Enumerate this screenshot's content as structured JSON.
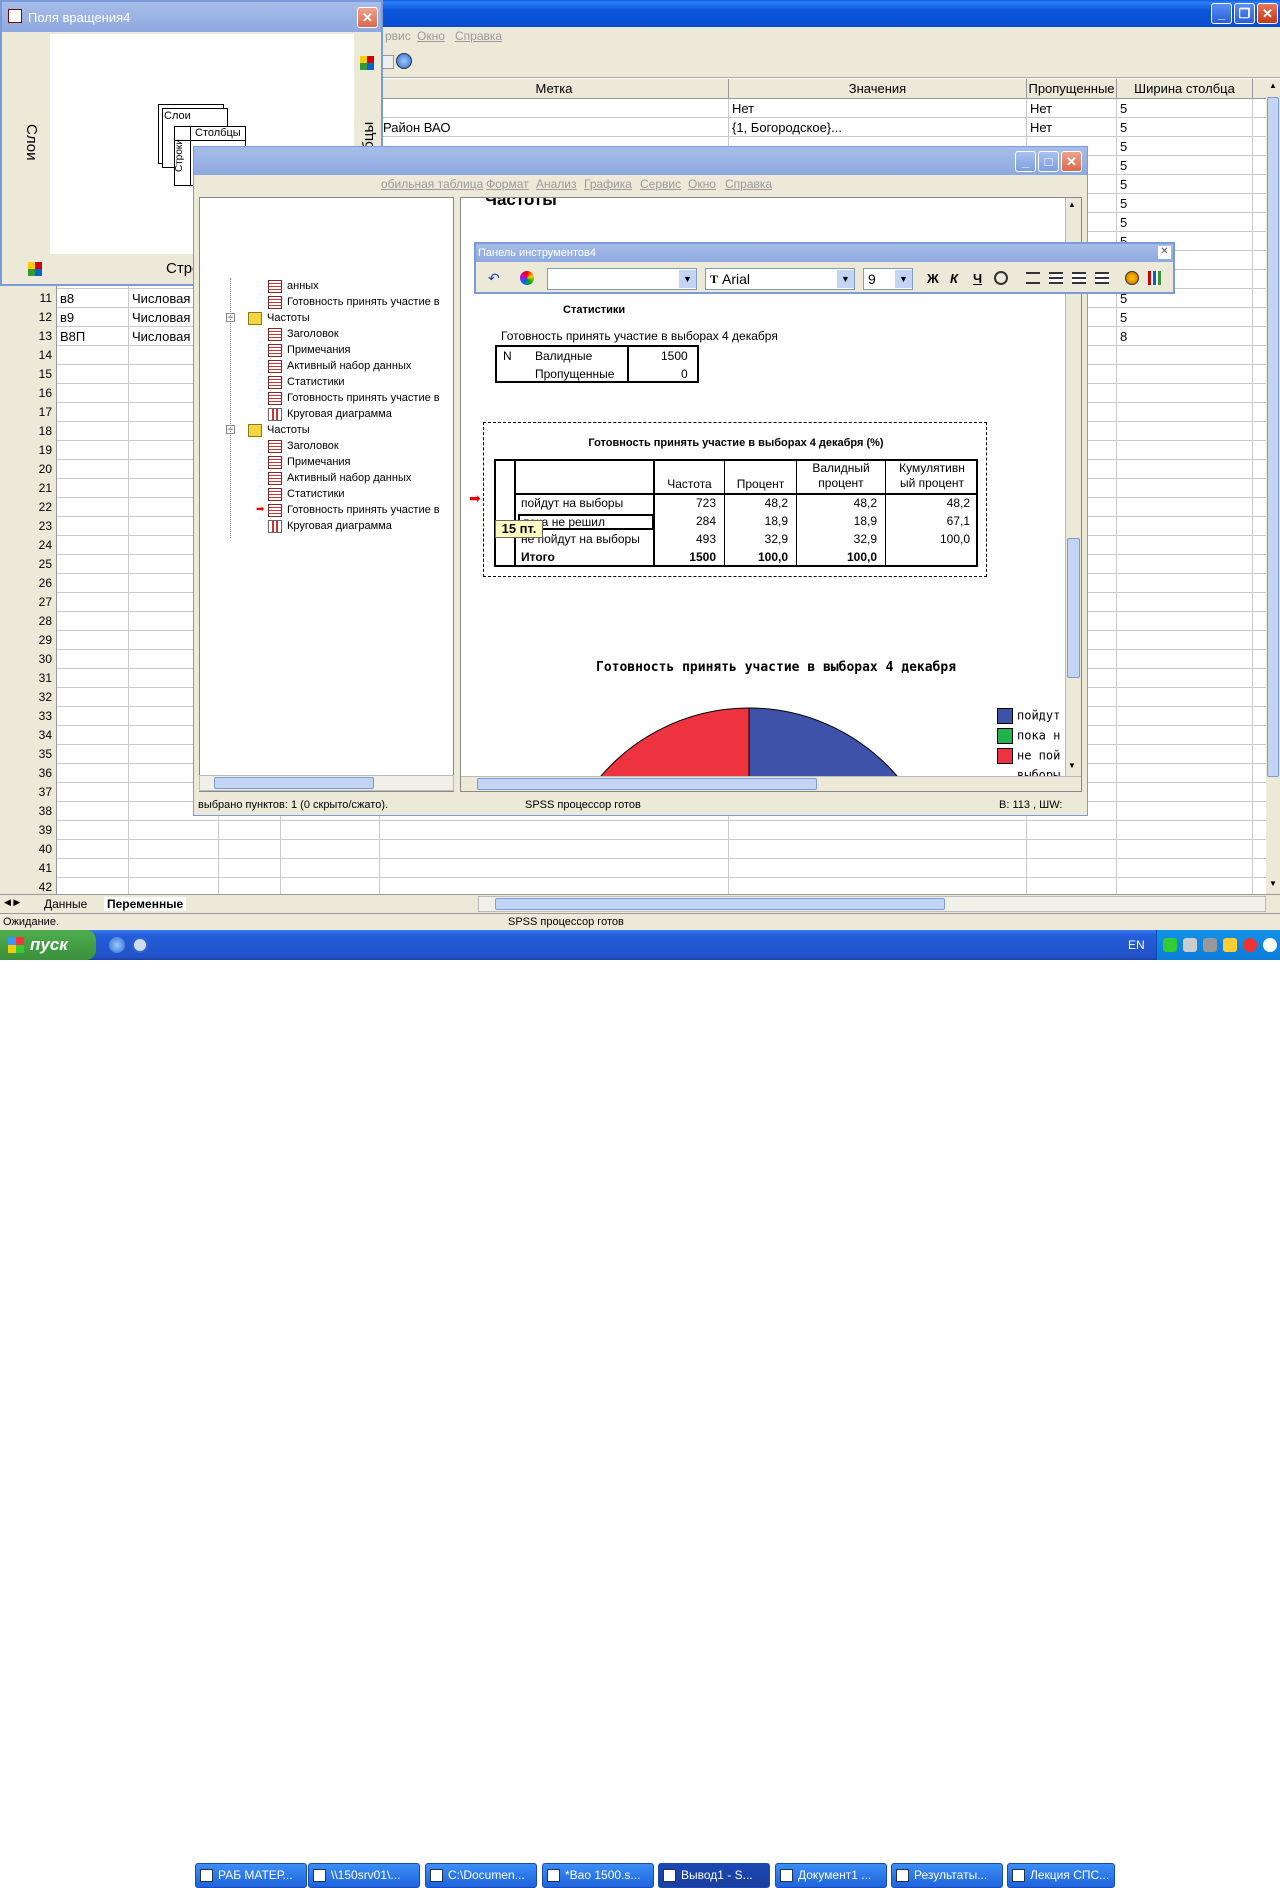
{
  "data_editor": {
    "menu": [
      "рвис",
      "Окно",
      "Справка"
    ],
    "columns": [
      "Метка",
      "Значения",
      "Пропущенные",
      "Ширина столбца"
    ],
    "rows": [
      {
        "num": "",
        "name": "",
        "type": "",
        "label": "",
        "values": "Нет",
        "missing": "Нет",
        "width": "5"
      },
      {
        "num": "",
        "name": "",
        "type": "",
        "label": "Район ВАО",
        "values": "{1, Богородское}...",
        "missing": "Нет",
        "width": "5"
      },
      {
        "num": "",
        "name": "",
        "type": "",
        "label": "",
        "values": "",
        "missing": "",
        "width": "5"
      },
      {
        "num": "",
        "name": "",
        "type": "",
        "label": "",
        "values": "",
        "missing": "",
        "width": "5"
      },
      {
        "num": "",
        "name": "",
        "type": "",
        "label": "",
        "values": "",
        "missing": "",
        "width": "5"
      },
      {
        "num": "",
        "name": "",
        "type": "",
        "label": "",
        "values": "",
        "missing": "",
        "width": "5"
      },
      {
        "num": "",
        "name": "",
        "type": "",
        "label": "",
        "values": "",
        "missing": "",
        "width": "5"
      },
      {
        "num": "",
        "name": "",
        "type": "",
        "label": "",
        "values": "",
        "missing": "",
        "width": "5"
      },
      {
        "num": "",
        "name": "",
        "type": "",
        "label": "",
        "values": "",
        "missing": "",
        "width": "5"
      },
      {
        "num": "",
        "name": "",
        "type": "",
        "label": "",
        "values": "",
        "missing": "",
        "width": "5"
      },
      {
        "num": "11",
        "name": "в8",
        "type": "Числовая",
        "label": "",
        "values": "",
        "missing": "",
        "width": "5"
      },
      {
        "num": "12",
        "name": "в9",
        "type": "Числовая",
        "label": "",
        "values": "",
        "missing": "",
        "width": "5"
      },
      {
        "num": "13",
        "name": "В8П",
        "type": "Числовая",
        "label": "",
        "values": "",
        "missing": "",
        "width": "8"
      }
    ],
    "empty_rows": [
      "14",
      "15",
      "16",
      "17",
      "18",
      "19",
      "20",
      "21",
      "22",
      "23",
      "24",
      "25",
      "26",
      "27",
      "28",
      "29",
      "30",
      "31",
      "32",
      "33",
      "34",
      "35",
      "36",
      "37",
      "38",
      "39",
      "40",
      "41",
      "42"
    ],
    "tabs": [
      "Данные",
      "Переменные"
    ],
    "status_left": "Ожидание.",
    "status_center": "SPSS процессор готов"
  },
  "pivot_window": {
    "title": "Поля вращения4",
    "label_layers": "Слои",
    "label_columns": "Столбцы",
    "label_rows": "Строки",
    "diagram_layers": "Слои",
    "diagram_columns": "Столбцы",
    "diagram_rows": "Строки"
  },
  "viewer": {
    "menu": [
      "обильная таблица",
      "Формат",
      "Анализ",
      "Графика",
      "Сервис",
      "Окно",
      "Справка"
    ],
    "tree": [
      {
        "label": "анных",
        "indent": 2,
        "icon": "table",
        "partial": true
      },
      {
        "label": "Готовность принять участие в",
        "indent": 2,
        "icon": "table"
      },
      {
        "label": "Частоты",
        "indent": 1,
        "icon": "folder"
      },
      {
        "label": "Заголовок",
        "indent": 2,
        "icon": "table"
      },
      {
        "label": "Примечания",
        "indent": 2,
        "icon": "table"
      },
      {
        "label": "Активный набор данных",
        "indent": 2,
        "icon": "table"
      },
      {
        "label": "Статистики",
        "indent": 2,
        "icon": "table"
      },
      {
        "label": "Готовность принять участие в",
        "indent": 2,
        "icon": "table"
      },
      {
        "label": "Круговая диаграмма",
        "indent": 2,
        "icon": "chart"
      },
      {
        "label": "Частоты",
        "indent": 1,
        "icon": "folder"
      },
      {
        "label": "Заголовок",
        "indent": 2,
        "icon": "table"
      },
      {
        "label": "Примечания",
        "indent": 2,
        "icon": "table"
      },
      {
        "label": "Активный набор данных",
        "indent": 2,
        "icon": "table"
      },
      {
        "label": "Статистики",
        "indent": 2,
        "icon": "table"
      },
      {
        "label": "Готовность принять участие в",
        "indent": 2,
        "icon": "table",
        "selected": true
      },
      {
        "label": "Круговая диаграмма",
        "indent": 2,
        "icon": "chart"
      }
    ],
    "heading": "Частоты",
    "stats_title": "Статистики",
    "stats_subtitle": "Готовность принять участие в выборах 4 декабря",
    "stats_n": "N",
    "stats_valid": "Валидные",
    "stats_valid_val": "1500",
    "stats_missing": "Пропущенные",
    "stats_missing_val": "0",
    "freq_title": "Готовность принять участие в выборах 4 декабря (%)",
    "freq_headers": [
      "Частота",
      "Процент",
      "Валидный процент",
      "Кумулятивный процент"
    ],
    "freq_header_lines": [
      [
        "Частота"
      ],
      [
        "Процент"
      ],
      [
        "Валидный",
        "процент"
      ],
      [
        "Кумулятивн",
        "ый процент"
      ]
    ],
    "freq_rows": [
      {
        "label": "пойдут на выборы",
        "f": "723",
        "p": "48,2",
        "vp": "48,2",
        "cp": "48,2"
      },
      {
        "label": "пока не решил",
        "f": "284",
        "p": "18,9",
        "vp": "18,9",
        "cp": "67,1"
      },
      {
        "label": "не пойдут на выборы",
        "f": "493",
        "p": "32,9",
        "vp": "32,9",
        "cp": "100,0"
      },
      {
        "label": "Итого",
        "f": "1500",
        "p": "100,0",
        "vp": "100,0",
        "cp": ""
      }
    ],
    "font_tip": "15 пт.",
    "chart_title": "Готовность принять участие в выборах 4 декабря",
    "legend": [
      {
        "label": "пойдут",
        "color": "#3d52a8"
      },
      {
        "label": "пока н",
        "color": "#22b24c"
      },
      {
        "label": "не пой",
        "color": "#ee3340"
      },
      {
        "label": "выборы",
        "color": "#ee3340"
      }
    ],
    "status_left": "выбрано пунктов: 1  (0 скрыто/сжато).",
    "status_center": "SPSS процессор готов",
    "status_right": "В: 113 , ШW:"
  },
  "format_toolbar": {
    "title": "Панель инструментов4",
    "font": "Arial",
    "size": "9",
    "bold": "Ж",
    "italic": "К",
    "underline": "Ч"
  },
  "taskbar": {
    "start": "пуск",
    "buttons": [
      "РАБ МАТЕР...",
      "\\\\150srv01\\...",
      "C:\\Documen...",
      "*Вао 1500.s...",
      "Вывод1 - S...",
      "Документ1 ...",
      "Результаты...",
      "Лекция СПС..."
    ],
    "lang": "EN"
  },
  "chart_data": {
    "type": "pie",
    "title": "Готовность принять участие в выборах 4 декабря",
    "categories": [
      "пойдут на выборы",
      "пока не решил",
      "не пойдут на выборы"
    ],
    "values": [
      48.2,
      18.9,
      32.9
    ],
    "colors": [
      "#3d52a8",
      "#22b24c",
      "#ee3340"
    ]
  }
}
